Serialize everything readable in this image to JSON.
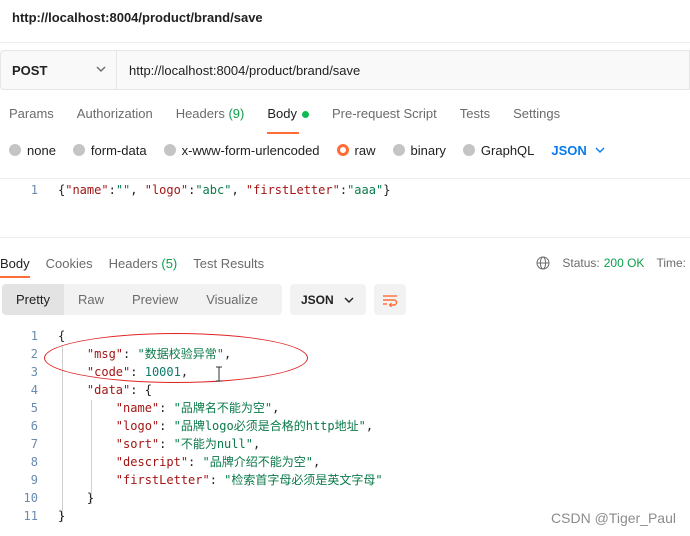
{
  "window": {
    "title": "http://localhost:8004/product/brand/save"
  },
  "request": {
    "method": "POST",
    "url": "http://localhost:8004/product/brand/save"
  },
  "request_tabs": [
    {
      "label": "Params"
    },
    {
      "label": "Authorization"
    },
    {
      "label": "Headers",
      "count": "(9)"
    },
    {
      "label": "Body"
    },
    {
      "label": "Pre-request Script"
    },
    {
      "label": "Tests"
    },
    {
      "label": "Settings"
    }
  ],
  "body_types": {
    "none": "none",
    "form_data": "form-data",
    "urlencoded": "x-www-form-urlencoded",
    "raw": "raw",
    "binary": "binary",
    "graphql": "GraphQL",
    "language": "JSON"
  },
  "request_body": {
    "line_number": "1",
    "tokens": {
      "open": "{",
      "k1": "\"name\"",
      "c1": ":",
      "v1": "\"\"",
      "sep1": ", ",
      "k2": "\"logo\"",
      "c2": ":",
      "v2": "\"abc\"",
      "sep2": ", ",
      "k3": "\"firstLetter\"",
      "c3": ":",
      "v3": "\"aaa\"",
      "close": "}"
    }
  },
  "response_tabs": {
    "body": "Body",
    "cookies": "Cookies",
    "headers": "Headers",
    "headers_count": "(5)",
    "test_results": "Test Results"
  },
  "status": {
    "label": "Status:",
    "value": "200 OK",
    "time_label": "Time:"
  },
  "view_modes": {
    "pretty": "Pretty",
    "raw": "Raw",
    "preview": "Preview",
    "visualize": "Visualize",
    "format": "JSON"
  },
  "response_lines": [
    {
      "n": "1",
      "indent": "",
      "key": "",
      "sep": "",
      "val": "",
      "valtype": "p",
      "text": "{"
    },
    {
      "n": "2",
      "indent": "    ",
      "key": "\"msg\"",
      "sep": ": ",
      "val": "\"数据校验异常\"",
      "valtype": "s",
      "text": ","
    },
    {
      "n": "3",
      "indent": "    ",
      "key": "\"code\"",
      "sep": ": ",
      "val": "10001",
      "valtype": "n",
      "text": ","
    },
    {
      "n": "4",
      "indent": "    ",
      "key": "\"data\"",
      "sep": ": ",
      "val": "",
      "valtype": "p",
      "text": "{"
    },
    {
      "n": "5",
      "indent": "        ",
      "key": "\"name\"",
      "sep": ": ",
      "val": "\"品牌名不能为空\"",
      "valtype": "s",
      "text": ","
    },
    {
      "n": "6",
      "indent": "        ",
      "key": "\"logo\"",
      "sep": ": ",
      "val": "\"品牌logo必须是合格的http地址\"",
      "valtype": "s",
      "text": ","
    },
    {
      "n": "7",
      "indent": "        ",
      "key": "\"sort\"",
      "sep": ": ",
      "val": "\"不能为null\"",
      "valtype": "s",
      "text": ","
    },
    {
      "n": "8",
      "indent": "        ",
      "key": "\"descript\"",
      "sep": ": ",
      "val": "\"品牌介绍不能为空\"",
      "valtype": "s",
      "text": ","
    },
    {
      "n": "9",
      "indent": "        ",
      "key": "\"firstLetter\"",
      "sep": ": ",
      "val": "\"检索首字母必须是英文字母\"",
      "valtype": "s",
      "text": ""
    },
    {
      "n": "10",
      "indent": "    ",
      "key": "",
      "sep": "",
      "val": "",
      "valtype": "p",
      "text": "}"
    },
    {
      "n": "11",
      "indent": "",
      "key": "",
      "sep": "",
      "val": "",
      "valtype": "p",
      "text": "}"
    }
  ],
  "watermark": "CSDN @Tiger_Paul",
  "colors": {
    "accent": "#ff6c37",
    "success": "#0a9f4a",
    "link": "#097bed",
    "annotation": "#e02424"
  }
}
